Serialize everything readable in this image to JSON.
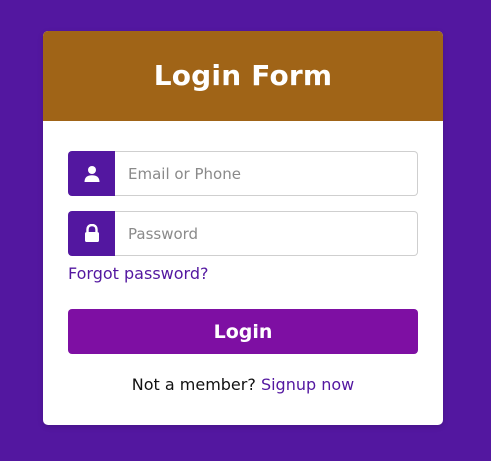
{
  "form": {
    "title": "Login Form",
    "email": {
      "placeholder": "Email or Phone",
      "icon": "user-icon"
    },
    "password": {
      "placeholder": "Password",
      "icon": "lock-icon"
    },
    "forgot_link": "Forgot password?",
    "login_button": "Login",
    "signup_prompt": "Not a member?",
    "signup_link": "Signup now"
  },
  "colors": {
    "background": "#5317a0",
    "header": "#a06417",
    "icon_bg": "#5317a0",
    "button": "#7e0fa3",
    "link": "#5317a0"
  }
}
